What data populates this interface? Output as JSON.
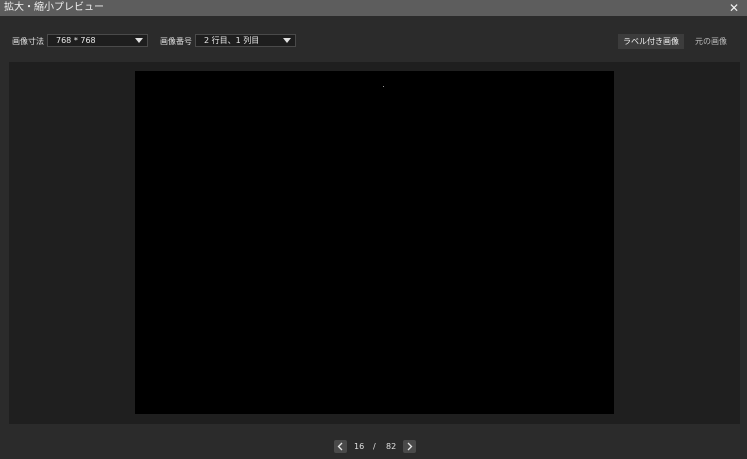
{
  "window": {
    "title": "拡大・縮小プレビュー",
    "close_glyph": "✕"
  },
  "toolbar": {
    "size_label": "画像寸法",
    "size_value": "768 * 768",
    "index_label": "画像番号",
    "index_value": "2 行目、1 列目",
    "tab_labeled": "ラベル付き画像",
    "tab_original": "元の画像",
    "active_tab": "tab_labeled"
  },
  "pagination": {
    "current": "16",
    "separator": "/",
    "total": "82"
  },
  "icons": {
    "close": "close-icon",
    "dropdown": "chevron-down-icon",
    "prev": "chevron-left-icon",
    "next": "chevron-right-icon"
  },
  "colors": {
    "titlebar": "#5d5d5d",
    "window_bg": "#2b2b2b",
    "panel_bg": "#1f1f1f",
    "image_bg": "#000000",
    "active_tab_bg": "#3c3c3c"
  }
}
